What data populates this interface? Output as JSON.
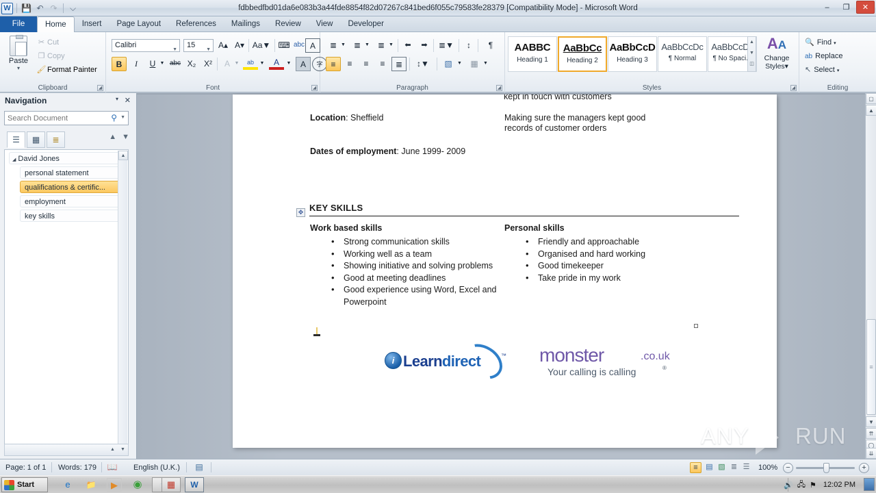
{
  "window": {
    "title": "fdbbedfbd01da6e083b3a44fde8854f82d07267c841bed6f055c79583fe28379 [Compatibility Mode]  -  Microsoft Word",
    "minimize": "–",
    "restore": "❐",
    "close": "✕"
  },
  "qat": {
    "logo": "W",
    "save": "💾",
    "undo": "↶",
    "redo": "↷",
    "customize": "⌵"
  },
  "tabs": [
    {
      "label": "File",
      "active": false
    },
    {
      "label": "Home",
      "active": true
    },
    {
      "label": "Insert",
      "active": false
    },
    {
      "label": "Page Layout",
      "active": false
    },
    {
      "label": "References",
      "active": false
    },
    {
      "label": "Mailings",
      "active": false
    },
    {
      "label": "Review",
      "active": false
    },
    {
      "label": "View",
      "active": false
    },
    {
      "label": "Developer",
      "active": false
    }
  ],
  "ribbon": {
    "clipboard": {
      "group_label": "Clipboard",
      "paste": "Paste",
      "paste_arrow": "▾",
      "cut": "Cut",
      "cut_icon": "✂",
      "copy": "Copy",
      "copy_icon": "❐",
      "format_painter": "Format Painter",
      "format_painter_icon": "🖌"
    },
    "font": {
      "group_label": "Font",
      "font_name": "Calibri",
      "font_size": "15",
      "grow_font": "A▴",
      "shrink_font": "A▾",
      "change_case": "Aa",
      "clear_formatting": "⌨",
      "phonetic_guide": "abc",
      "character_border": "A",
      "bold": "B",
      "italic": "I",
      "underline": "U",
      "strikethrough": "abc",
      "subscript": "X₂",
      "superscript": "X²",
      "text_effects": "A",
      "highlight": "ab",
      "font_color": "A",
      "shading": "A",
      "enclose_characters": "字"
    },
    "paragraph": {
      "group_label": "Paragraph",
      "bullets": "≣",
      "numbering": "≣",
      "multilevel": "≣",
      "decrease_indent": "⬅",
      "increase_indent": "➡",
      "sort": "↕",
      "show_marks": "¶",
      "align_left": "≡",
      "align_center": "≡",
      "align_right": "≡",
      "justify": "≡",
      "asian_layout": "≣",
      "line_spacing": "↕",
      "shading": "▧",
      "borders": "▦"
    },
    "styles": {
      "group_label": "Styles",
      "items": [
        {
          "preview": "AABBC",
          "name": "Heading 1",
          "selected": false
        },
        {
          "preview": "AaBbCc",
          "name": "Heading 2",
          "selected": true
        },
        {
          "preview": "AaBbCcD",
          "name": "Heading 3",
          "selected": false
        },
        {
          "preview": "AaBbCcDc",
          "name": "¶ Normal",
          "selected": false
        },
        {
          "preview": "AaBbCcDc",
          "name": "¶ No Spaci...",
          "selected": false
        }
      ],
      "change_styles": "Change Styles",
      "change_styles_arrow": "▾"
    },
    "editing": {
      "group_label": "Editing",
      "find": "Find",
      "find_icon": "🔍",
      "find_arrow": "▾",
      "replace": "Replace",
      "replace_icon": "ab",
      "select": "Select",
      "select_icon": "↖",
      "select_arrow": "▾"
    }
  },
  "navigation": {
    "title": "Navigation",
    "options_arrow": "▾",
    "close": "✕",
    "search_placeholder": "Search Document",
    "search_value": "",
    "search_icon": "🔍",
    "search_arrow": "▾",
    "tabs": [
      {
        "icon": "☰",
        "name": "browse-headings",
        "active": true
      },
      {
        "icon": "▦",
        "name": "browse-pages",
        "active": false
      },
      {
        "icon": "≣",
        "name": "browse-results",
        "active": false
      }
    ],
    "prev": "▲",
    "next": "▼",
    "headings": [
      {
        "label": "David Jones",
        "level": 0,
        "selected": false,
        "triangle": "◢"
      },
      {
        "label": "personal statement",
        "level": 1,
        "selected": false
      },
      {
        "label": "qualifications & certific...",
        "level": 1,
        "selected": true
      },
      {
        "label": "employment",
        "level": 1,
        "selected": false
      },
      {
        "label": "key skills",
        "level": 1,
        "selected": false
      }
    ],
    "scroll_up": "▲",
    "scroll_down": "▼"
  },
  "document": {
    "clipped_line": "kept in touch with customers",
    "location_label": "Location",
    "location_value": ": Sheffield",
    "dates_label": "Dates of employment",
    "dates_value": ": June 1999- 2009",
    "right_para": "Making sure the managers kept good records of customer orders",
    "key_skills_heading": "KEY SKILLS",
    "move_handle": "✥",
    "work_skills_heading": "Work based skills",
    "work_skills": [
      "Strong communication skills",
      "Working well as a team",
      "Showing initiative and solving problems",
      "Good at meeting deadlines",
      "Good experience using Word, Excel and Powerpoint"
    ],
    "personal_skills_heading": "Personal skills",
    "personal_skills": [
      "Friendly and approachable",
      "Organised and hard working",
      "Good timekeeper",
      "",
      "Take pride in my work"
    ],
    "logo_learndirect": {
      "mark": "i",
      "word_a": "Learn",
      "word_b": "direct",
      "tm": "™"
    },
    "logo_monster": {
      "word": "monster",
      "domain": ".co.uk",
      "tagline": "Your calling is calling",
      "tm": "®"
    }
  },
  "watermark": {
    "left": "ANY",
    "right": "RUN"
  },
  "status": {
    "page": "Page: 1 of 1",
    "words": "Words: 179",
    "proofing_icon": "📖",
    "language": "English (U.K.)",
    "macro_icon": "▤",
    "views": [
      {
        "icon": "≡",
        "name": "print-layout",
        "active": true
      },
      {
        "icon": "▤",
        "name": "full-screen-reading",
        "active": false
      },
      {
        "icon": "▧",
        "name": "web-layout",
        "active": false
      },
      {
        "icon": "≣",
        "name": "outline",
        "active": false
      },
      {
        "icon": "☰",
        "name": "draft",
        "active": false
      }
    ],
    "zoom": "100%",
    "zoom_out": "−",
    "zoom_in": "+"
  },
  "taskbar": {
    "start": "Start",
    "items": [
      {
        "name": "internet-explorer",
        "glyph": "e",
        "color": "#1a73c8"
      },
      {
        "name": "windows-explorer",
        "glyph": "📁",
        "color": "#d9a43a"
      },
      {
        "name": "media-player",
        "glyph": "▶",
        "color": "#e08a28"
      },
      {
        "name": "google-chrome",
        "glyph": "◉",
        "color": "#3aa03a"
      },
      {
        "name": "microsoft-edge",
        "glyph": "◔",
        "color": "#1f8fd4"
      },
      {
        "name": "app-colorful",
        "glyph": "▦",
        "color": "#c0392b"
      },
      {
        "name": "microsoft-word",
        "glyph": "W",
        "color": "#1e5fa9"
      }
    ],
    "tray": {
      "volume": "🔊",
      "network": "🖧",
      "flag": "⚑",
      "clock": "12:02 PM"
    }
  }
}
